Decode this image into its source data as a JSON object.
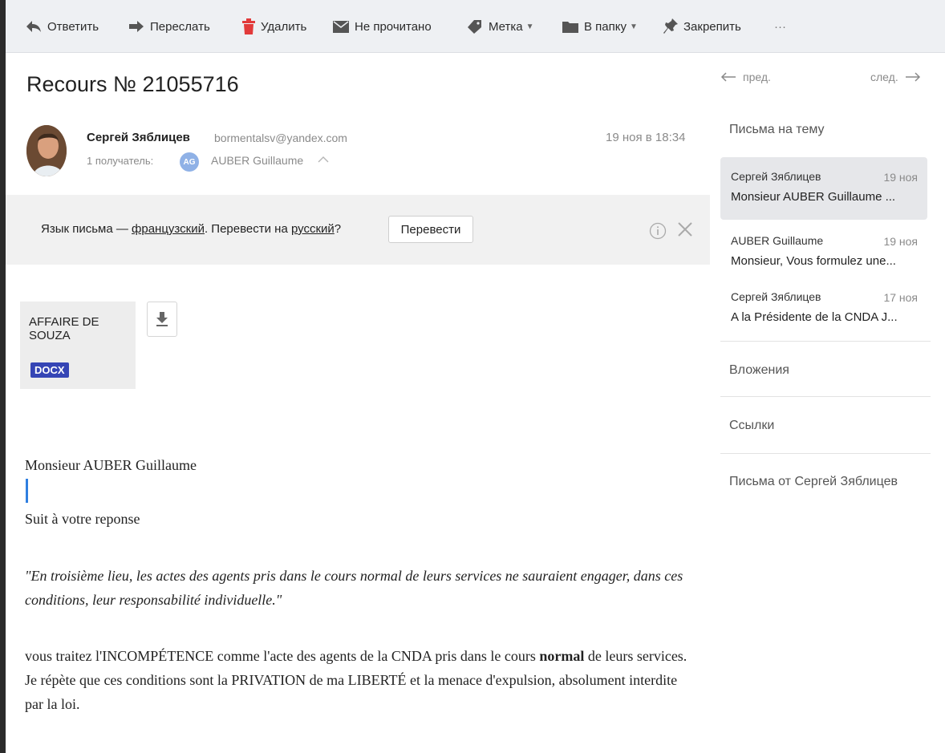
{
  "toolbar": {
    "reply": "Ответить",
    "forward": "Переслать",
    "delete": "Удалить",
    "unread": "Не прочитано",
    "label": "Метка",
    "folder": "В папку",
    "pin": "Закрепить",
    "more": "···",
    "dropdown_arrow": "▼"
  },
  "message": {
    "subject": "Recours № 21055716",
    "sender_name": "Сергей Зяблицев",
    "sender_email": "bormentalsv@yandex.com",
    "date": "19 ноя в 18:34",
    "recipients_label": "1 получатель:",
    "recipient_initials": "AG",
    "recipient_name": "AUBER Guillaume",
    "recipient_toggle": "^"
  },
  "translate": {
    "prefix": "Язык письма — ",
    "from_lang": "французский",
    "middle": ". Перевести на ",
    "to_lang": "русский",
    "suffix": "?",
    "button": "Перевести",
    "close_glyph": "✕"
  },
  "attachment": {
    "name": "AFFAIRE DE SOUZA",
    "type": "DOCX"
  },
  "body": {
    "greeting": "Monsieur AUBER Guillaume",
    "line1": "Suit à votre reponse",
    "quote": "\"En troisième lieu, les actes des agents pris dans le cours normal de leurs services ne sauraient engager, dans ces conditions, leur responsabilité individuelle.\"",
    "p2_part1": "vous traitez  l'INCOMPÉTENCE comme l'acte des agents  de la CNDA pris dans le cours ",
    "p2_bold": "normal",
    "p2_part2": " de leurs services. Je répète que ces conditions sont la PRIVATION de ma LIBERTÉ et la menace d'expulsion, absolument interdite par la loi."
  },
  "sidebar": {
    "prev": "пред.",
    "next": "след.",
    "thread_title": "Письма на тему",
    "thread": [
      {
        "from": "Сергей Зяблицев",
        "date": "19 ноя",
        "snippet": "Monsieur AUBER Guillaume ..."
      },
      {
        "from": "AUBER Guillaume",
        "date": "19 ноя",
        "snippet": "Monsieur, Vous formulez une..."
      },
      {
        "from": "Сергей Зяблицев",
        "date": "17 ноя",
        "snippet": "A la Présidente de la CNDA J..."
      }
    ],
    "attachments": "Вложения",
    "links": "Ссылки",
    "from_sender": "Письма от Сергей Зяблицев"
  },
  "colors": {
    "accent_blue": "#2f7fe0",
    "delete_red": "#e23a3a",
    "docx_badge": "#3545b5"
  }
}
